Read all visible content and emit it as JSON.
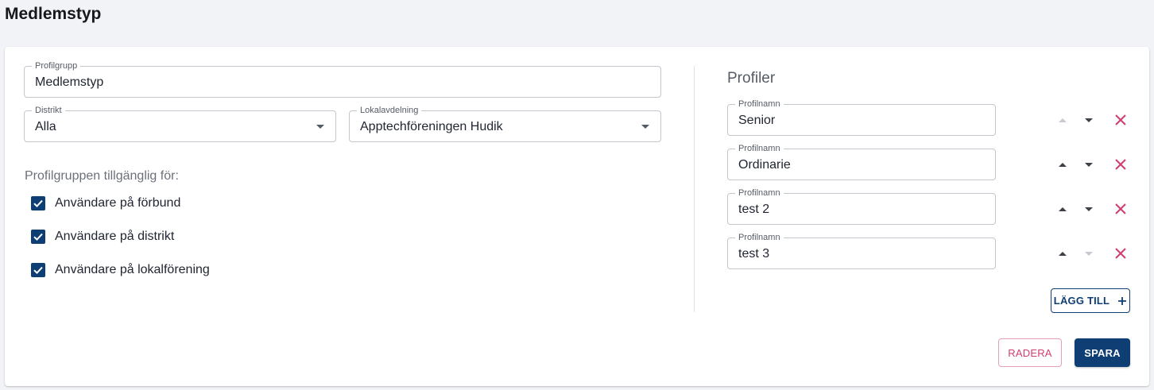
{
  "page": {
    "title": "Medlemstyp"
  },
  "form": {
    "profilgrupp": {
      "label": "Profilgrupp",
      "value": "Medlemstyp"
    },
    "distrikt": {
      "label": "Distrikt",
      "value": "Alla"
    },
    "lokalavdelning": {
      "label": "Lokalavdelning",
      "value": "Apptechföreningen Hudik"
    },
    "availability": {
      "label": "Profilgruppen tillgänglig för:",
      "options": [
        {
          "label": "Användare på förbund",
          "checked": true
        },
        {
          "label": "Användare på distrikt",
          "checked": true
        },
        {
          "label": "Användare på lokalförening",
          "checked": true
        }
      ]
    }
  },
  "profiles": {
    "title": "Profiler",
    "field_label": "Profilnamn",
    "items": [
      {
        "name": "Senior",
        "up_enabled": false,
        "down_enabled": true
      },
      {
        "name": "Ordinarie",
        "up_enabled": true,
        "down_enabled": true
      },
      {
        "name": "test 2",
        "up_enabled": true,
        "down_enabled": true
      },
      {
        "name": "test 3",
        "up_enabled": true,
        "down_enabled": false
      }
    ],
    "add_label": "LÄGG TILL"
  },
  "actions": {
    "delete_label": "RADERA",
    "save_label": "SPARA"
  },
  "colors": {
    "primary": "#0f3e74",
    "danger": "#d23d6e",
    "background": "#f1f3f7"
  }
}
